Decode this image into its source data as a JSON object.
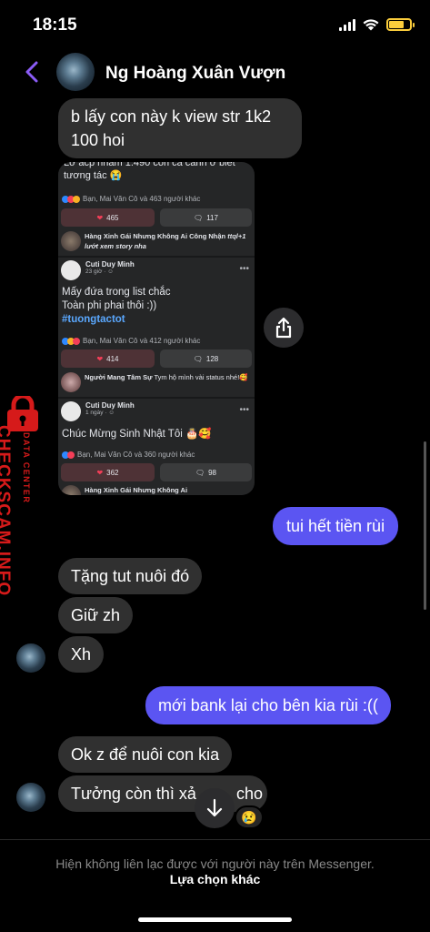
{
  "status_bar": {
    "time": "18:15"
  },
  "header": {
    "contact_name": "Ng Hoàng Xuân Vượn"
  },
  "messages": [
    {
      "dir": "in",
      "text": "b lấy con này k view str 1k2 100 hoi"
    },
    {
      "dir": "out",
      "text": "tui hết tiền rùi"
    },
    {
      "dir": "in",
      "text": "Tặng tut nuôi đó"
    },
    {
      "dir": "in",
      "text": "Giữ zh"
    },
    {
      "dir": "in",
      "text": "Xh"
    },
    {
      "dir": "out",
      "text": "mới bank lại cho bên kia rùi :(("
    },
    {
      "dir": "in",
      "text": "Ok z để nuôi con kia"
    },
    {
      "dir": "in",
      "text": "Tưởng còn thì xả",
      "text_end": "cho",
      "reaction": "😢"
    }
  ],
  "shared_image": {
    "post1": {
      "text": "Lỡ acp nhầm 1.490 con cá cảnh ớ biết tương tác 😭",
      "reactions": "Bạn, Mai Văn Cô và 463 người khác",
      "likes": "465",
      "comments": "117",
      "top_comment_text": "Hàng Xinh Gái Nhưng Không Ai Công Nhận",
      "top_comment_extra": "ttql+1 lướt xem story nha"
    },
    "post2": {
      "author": "Cuti Duy Minh",
      "time": "23 giờ · ☺",
      "line1": "Mấy đứa trong list chắc",
      "line2": "Toàn phi phai thôi :))",
      "hashtag": "#tuongtactot",
      "reactions": "Bạn, Mai Văn Cô và 412 người khác",
      "likes": "414",
      "comments": "128",
      "top_comment_author": "Người Mang Tâm Sự",
      "top_comment_text": "Tym hộ mình vài status nhé!🥰"
    },
    "post3": {
      "author": "Cuti Duy Minh",
      "time": "1 ngày · ☺",
      "text": "Chúc Mừng Sinh Nhật Tôi 🎂🥰",
      "reactions": "Bạn, Mai Văn Cô và 360 người khác",
      "likes": "362",
      "comments": "98",
      "top_comment_text": "Hàng Xinh Gái Nhưng Không Ai"
    }
  },
  "watermark": {
    "main": "CHECKSCAM.INFO",
    "sub": "DATA CENTER"
  },
  "footer": {
    "note": "Hiện không liên lạc được với người này trên Messenger.",
    "link": "Lựa chọn khác"
  },
  "colors": {
    "outgoing_bubble": "#5b55f2",
    "incoming_bubble": "#303030",
    "back_arrow": "#8b5cf6",
    "watermark": "#d61a1a"
  },
  "icons": [
    "back-arrow-icon",
    "share-icon",
    "scroll-down-icon",
    "signal-icon",
    "wifi-icon",
    "battery-icon",
    "lock-icon"
  ]
}
